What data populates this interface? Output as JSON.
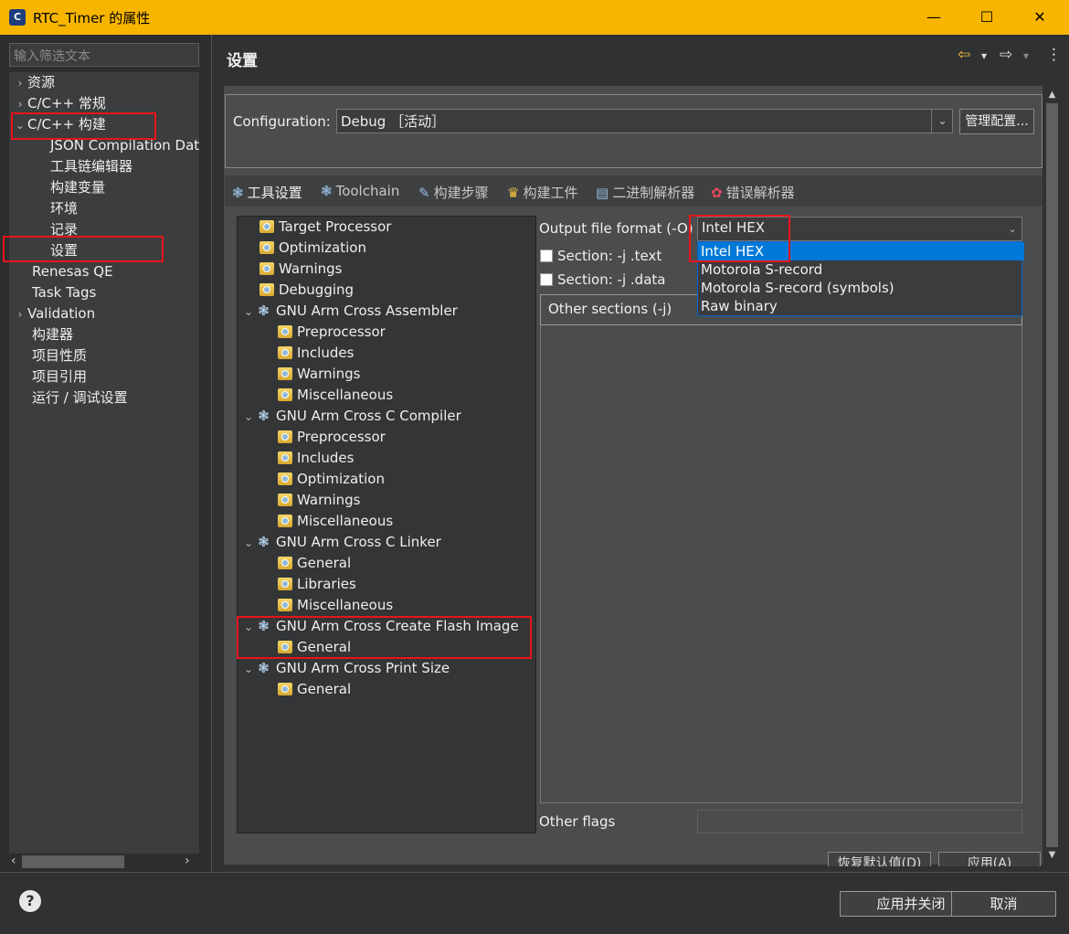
{
  "window": {
    "app_icon": "C",
    "title": "RTC_Timer 的属性",
    "minimize": "—",
    "maximize": "☐",
    "close": "✕"
  },
  "sidebar": {
    "filter_placeholder": "输入筛选文本",
    "items": [
      {
        "label": "资源",
        "chevron": "›"
      },
      {
        "label": "C/C++ 常规",
        "chevron": "›"
      },
      {
        "label": "C/C++ 构建",
        "chevron": "⌄"
      },
      {
        "label": "JSON Compilation Database"
      },
      {
        "label": "工具链编辑器"
      },
      {
        "label": "构建变量"
      },
      {
        "label": "环境"
      },
      {
        "label": "记录"
      },
      {
        "label": "设置"
      },
      {
        "label": "Renesas QE"
      },
      {
        "label": "Task Tags"
      },
      {
        "label": "Validation",
        "chevron": "›"
      },
      {
        "label": "构建器"
      },
      {
        "label": "项目性质"
      },
      {
        "label": "项目引用"
      },
      {
        "label": "运行 / 调试设置"
      }
    ],
    "scroll_left": "‹",
    "scroll_right": "›"
  },
  "header": {
    "title": "设置",
    "back_icon": "⇦",
    "forward_icon": "⇨",
    "dropdown_icon": "▾",
    "menu_icon": "⋮"
  },
  "configuration": {
    "label": "Configuration:",
    "value": "Debug ［活动］",
    "arrow": "⌄",
    "manage_button": "管理配置..."
  },
  "tabs": [
    {
      "label": "工具设置",
      "icon": "❃"
    },
    {
      "label": "Toolchain",
      "icon": "❃"
    },
    {
      "label": "构建步骤",
      "icon": "✎"
    },
    {
      "label": "构建工件",
      "icon": "♛"
    },
    {
      "label": "二进制解析器",
      "icon": "▤"
    },
    {
      "label": "错误解析器",
      "icon": "✿"
    }
  ],
  "tool_tree": {
    "expand_chevron": "⌄",
    "group_icon": "❃",
    "items": [
      {
        "label": "Target Processor"
      },
      {
        "label": "Optimization"
      },
      {
        "label": "Warnings"
      },
      {
        "label": "Debugging"
      },
      {
        "label": "GNU Arm Cross Assembler"
      },
      {
        "label": "Preprocessor"
      },
      {
        "label": "Includes"
      },
      {
        "label": "Warnings"
      },
      {
        "label": "Miscellaneous"
      },
      {
        "label": "GNU Arm Cross C Compiler"
      },
      {
        "label": "Preprocessor"
      },
      {
        "label": "Includes"
      },
      {
        "label": "Optimization"
      },
      {
        "label": "Warnings"
      },
      {
        "label": "Miscellaneous"
      },
      {
        "label": "GNU Arm Cross C Linker"
      },
      {
        "label": "General"
      },
      {
        "label": "Libraries"
      },
      {
        "label": "Miscellaneous"
      },
      {
        "label": "GNU Arm Cross Create Flash Image"
      },
      {
        "label": "General"
      },
      {
        "label": "GNU Arm Cross Print Size"
      },
      {
        "label": "General"
      }
    ]
  },
  "options": {
    "output_format_label": "Output file format (-O)",
    "output_format_value": "Intel HEX",
    "output_format_arrow": "⌄",
    "dropdown_options": [
      "Intel HEX",
      "Motorola S-record",
      "Motorola S-record (symbols)",
      "Raw binary"
    ],
    "section_text_label": "Section: -j .text",
    "section_data_label": "Section: -j .data",
    "other_sections_label": "Other sections (-j)",
    "other_flags_label": "Other flags",
    "restore_defaults_button": "恢复默认值(D)",
    "apply_button": "应用(A)"
  },
  "scrollbar": {
    "up": "▲",
    "down": "▼"
  },
  "footer": {
    "help_icon": "?",
    "apply_close_button": "应用并关闭",
    "cancel_button": "取消"
  },
  "colors": {
    "titlebar": "#f7b500",
    "highlight": "#e8141b",
    "selection": "#0078d7"
  }
}
